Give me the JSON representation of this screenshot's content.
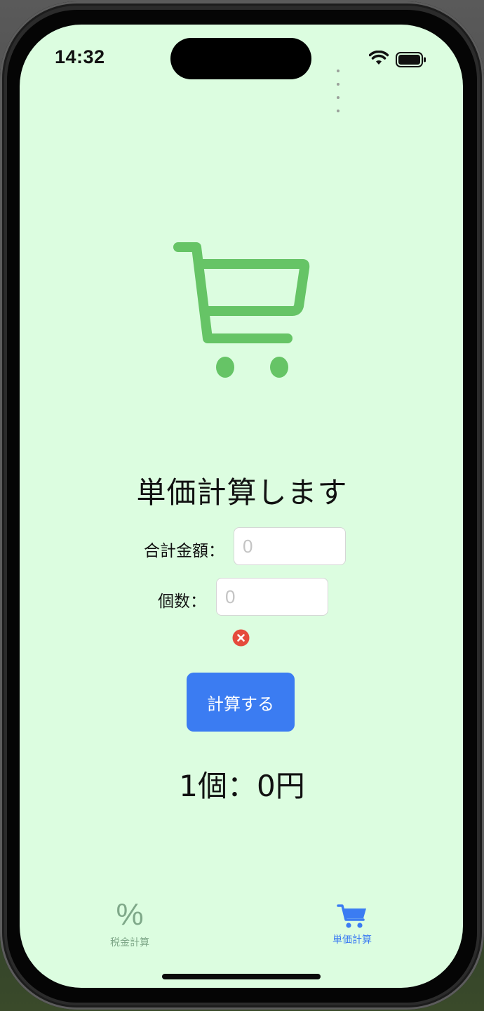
{
  "status_bar": {
    "time": "14:32"
  },
  "main": {
    "title": "単価計算します",
    "total_label": "合計金額：",
    "total_placeholder": "0",
    "count_label": "個数：",
    "count_placeholder": "0",
    "calc_button": "計算する",
    "result": "1個：0円"
  },
  "tab_bar": {
    "tabs": [
      {
        "label": "税金計算",
        "icon": "percent-icon",
        "selected": false
      },
      {
        "label": "単価計算",
        "icon": "cart-icon",
        "selected": true
      }
    ]
  },
  "colors": {
    "background": "#dcfde0",
    "accent": "#3b7cf2",
    "cart_green": "#66c466",
    "error_red": "#e54b3c"
  }
}
